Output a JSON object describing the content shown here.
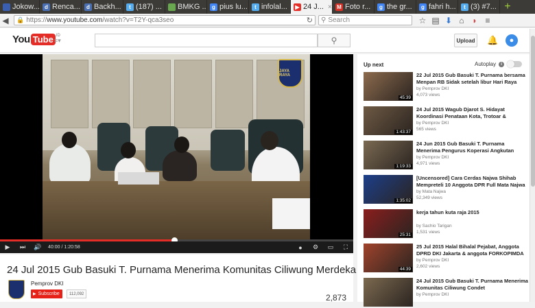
{
  "browser": {
    "tabs": [
      {
        "label": "Jokow...",
        "favicon_color": "#3b5fb0",
        "favicon_glyph": ""
      },
      {
        "label": "Renca...",
        "favicon_color": "#4a6fb3",
        "favicon_glyph": "d"
      },
      {
        "label": "Backh...",
        "favicon_color": "#4a6fb3",
        "favicon_glyph": "d"
      },
      {
        "label": "(187) ...",
        "favicon_color": "#55acee",
        "favicon_glyph": "t"
      },
      {
        "label": "BMKG ...",
        "favicon_color": "#6aa84f",
        "favicon_glyph": ""
      },
      {
        "label": "pius lu...",
        "favicon_color": "#4285f4",
        "favicon_glyph": "g"
      },
      {
        "label": "infolal...",
        "favicon_color": "#55acee",
        "favicon_glyph": "t"
      },
      {
        "label": "24 J...",
        "favicon_color": "#e52d27",
        "favicon_glyph": "▶"
      },
      {
        "label": "Foto r...",
        "favicon_color": "#d93025",
        "favicon_glyph": "M"
      },
      {
        "label": "the gr...",
        "favicon_color": "#4285f4",
        "favicon_glyph": "g"
      },
      {
        "label": "fahri h...",
        "favicon_color": "#4285f4",
        "favicon_glyph": "g"
      },
      {
        "label": "(3) #7...",
        "favicon_color": "#55acee",
        "favicon_glyph": "t"
      }
    ],
    "active_tab_index": 7,
    "url_scheme": "https://",
    "url_host": "www.youtube.com",
    "url_path": "/watch?v=T2Y-qca3seo",
    "search_placeholder": "Search"
  },
  "youtube": {
    "logo_text_you": "You",
    "logo_text_tube": "Tube",
    "logo_suffix": "ID",
    "upload_label": "Upload",
    "player": {
      "time_current": "40:00",
      "time_total": "1:20:58",
      "time_separator": " / ",
      "progress_fraction": 0.494,
      "seal_text": "JAYA RAYA"
    },
    "video": {
      "title": "24 Jul 2015 Gub Basuki T. Purnama Menerima Komunitas Ciliwung Merdeka",
      "channel": "Pemprov DKI",
      "subscribe_label": "Subscribe",
      "subscriber_count": "112,092",
      "view_count": "2,873"
    },
    "sidebar": {
      "up_next_label": "Up next",
      "autoplay_label": "Autoplay",
      "items": [
        {
          "title": "22 Jul 2015 Gub Basuki T. Purnama bersama Menpan RB Sidak setelah libur Hari Raya",
          "channel": "by Pemprov DKI",
          "views": "4,073 views",
          "duration": "45:39",
          "thumb_color": "#8c6b4e"
        },
        {
          "title": "24 Jul 2015 Wagub Djarot S. Hidayat Koordinasi Penataan Kota, Trotoar &",
          "channel": "by Pemprov DKI",
          "views": "565 views",
          "duration": "1:43:37",
          "thumb_color": "#6e5a44"
        },
        {
          "title": "24 Jun 2015 Gub Basuki T. Purnama Menerima Pengurus Koperasi Angkutan",
          "channel": "by Pemprov DKI",
          "views": "4,971 views",
          "duration": "1:19:33",
          "thumb_color": "#7a6a52"
        },
        {
          "title": "[Uncensored] Cara Cerdas Najwa Shihab Mempreteli 10 Anggota DPR Full Mata Najwa",
          "channel": "by Mata Najwa",
          "views": "52,349 views",
          "duration": "1:35:02",
          "thumb_color": "#1c3f8a"
        },
        {
          "title": "kerja tahun kuta raja 2015",
          "channel": "by Sachio Tarigan",
          "views": "1,531 views",
          "duration": "25:31",
          "thumb_color": "#8a1e1e"
        },
        {
          "title": "25 Jul 2015 Halal Bihalal Pejabat, Anggota DPRD DKI Jakarta & anggota FORKOPIMDA",
          "channel": "by Pemprov DKI",
          "views": "2,602 views",
          "duration": "44:39",
          "thumb_color": "#a0432c"
        },
        {
          "title": "24 Jul 2015 Gub Basuki T. Purnama Menerima Komunitas Ciliwung Condet",
          "channel": "by Pemprov DKI",
          "views": "",
          "duration": "",
          "thumb_color": "#7c6a50"
        }
      ]
    }
  }
}
